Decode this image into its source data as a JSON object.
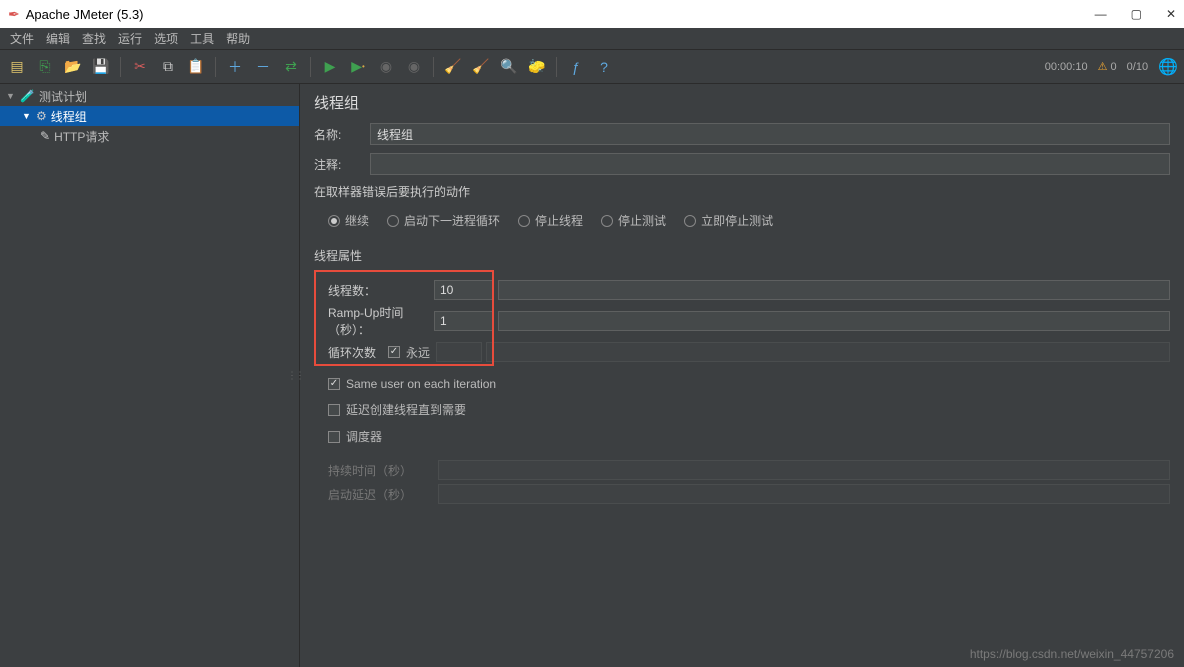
{
  "window": {
    "title": "Apache JMeter (5.3)"
  },
  "menu": [
    "文件",
    "编辑",
    "查找",
    "运行",
    "选项",
    "工具",
    "帮助"
  ],
  "toolbar_status": {
    "time": "00:00:10",
    "warn_count": "0",
    "threads": "0/10"
  },
  "tree": {
    "plan": "测试计划",
    "group": "线程组",
    "sampler": "HTTP请求"
  },
  "panel": {
    "title": "线程组",
    "name_label": "名称:",
    "name_value": "线程组",
    "comment_label": "注释:",
    "comment_value": "",
    "on_error_label": "在取样器错误后要执行的动作",
    "radios": {
      "continue": "继续",
      "next_loop": "启动下一进程循环",
      "stop_thread": "停止线程",
      "stop_test": "停止测试",
      "stop_now": "立即停止测试"
    },
    "props_label": "线程属性",
    "threads_label": "线程数：",
    "threads_value": "10",
    "ramp_label": "Ramp-Up时间（秒）：",
    "ramp_value": "1",
    "loop_label": "循环次数",
    "forever_label": "永远",
    "same_user_label": "Same user on each iteration",
    "delay_create_label": "延迟创建线程直到需要",
    "scheduler_label": "调度器",
    "duration_label": "持续时间（秒）",
    "startup_delay_label": "启动延迟（秒）"
  },
  "watermark": "https://blog.csdn.net/weixin_44757206"
}
